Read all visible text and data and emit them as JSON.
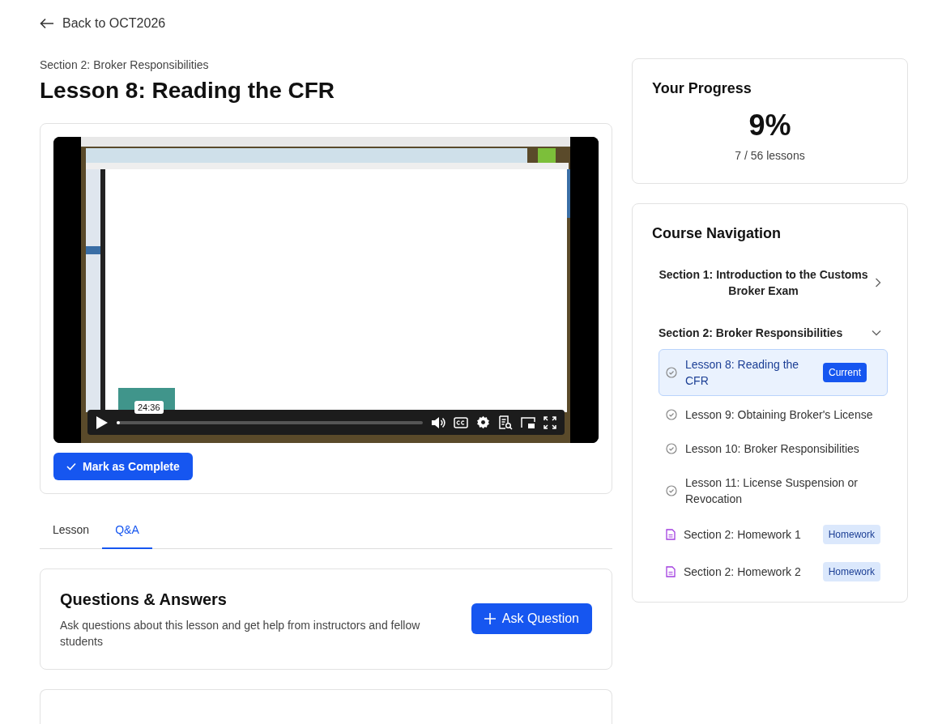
{
  "back_link": "Back to OCT2026",
  "breadcrumb": "Section 2: Broker Responsibilities",
  "title": "Lesson 8: Reading the CFR",
  "video": {
    "time_tooltip": "24:36",
    "level": 0.01
  },
  "complete_button": "Mark as Complete",
  "tabs": [
    {
      "label": "Lesson",
      "selected": false
    },
    {
      "label": "Q&A",
      "selected": true
    }
  ],
  "qa": {
    "title": "Questions & Answers",
    "description": "Ask questions about this lesson and get help from instructors and fellow students",
    "button": "Ask Question"
  },
  "progress": {
    "title": "Your Progress",
    "percent": "9%",
    "count": "7 / 56 lessons"
  },
  "navigation": {
    "title": "Course Navigation",
    "sections": [
      {
        "title": "Section 1: Introduction to the Customs Broker Exam",
        "expanded": false
      },
      {
        "title": "Section 2: Broker Responsibilities",
        "expanded": true,
        "children": [
          {
            "kind": "lesson",
            "label": "Lesson 8: Reading the CFR",
            "selected": true,
            "badge": "Current"
          },
          {
            "kind": "lesson",
            "label": "Lesson 9: Obtaining Broker's License",
            "selected": false
          },
          {
            "kind": "lesson",
            "label": "Lesson 10: Broker Responsibilities",
            "selected": false
          },
          {
            "kind": "lesson",
            "label": "Lesson 11: License Suspension or Revocation",
            "selected": false
          },
          {
            "kind": "homework",
            "label": "Section 2: Homework 1",
            "selected": false,
            "badge": "Homework"
          },
          {
            "kind": "homework",
            "label": "Section 2: Homework 2",
            "selected": false,
            "badge": "Homework"
          }
        ]
      }
    ]
  }
}
